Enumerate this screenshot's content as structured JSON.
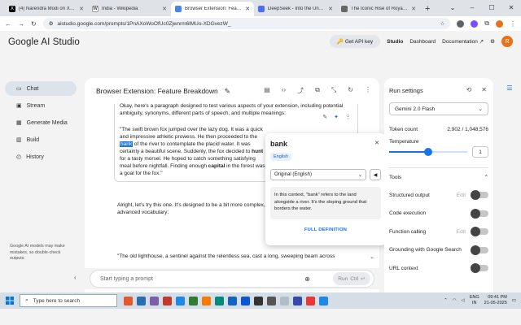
{
  "browser": {
    "tabs": [
      {
        "title": "(4) Narendra Modi on X: \"Dr",
        "favicon": "x-logo-icon",
        "color": "#000000",
        "letter": "X"
      },
      {
        "title": "India - Wikipedia",
        "favicon": "wikipedia-icon",
        "color": "#ffffff",
        "letter": "W"
      },
      {
        "title": "Browser Extension: Feature B",
        "favicon": "ai-studio-icon",
        "color": "#4285f4",
        "letter": "",
        "active": true
      },
      {
        "title": "DeepSeek - Into the Unknow",
        "favicon": "deepseek-icon",
        "color": "#4d6bfe",
        "letter": ""
      },
      {
        "title": "The Iconic Rise of Royal Enfi",
        "favicon": "page-icon",
        "color": "#666666",
        "letter": ""
      }
    ],
    "url": "aistudio.google.com/prompts/1PnAXoWoOfUc0Zjwnrm6lMUo-XDGvezW_"
  },
  "app": {
    "brand": "Google AI Studio",
    "get_api_key": "Get API key",
    "nav": [
      "Studio",
      "Dashboard",
      "Documentation"
    ],
    "avatar_letter": "R"
  },
  "sidebar": {
    "items": [
      {
        "label": "Chat",
        "icon": "chat-icon",
        "active": true
      },
      {
        "label": "Stream",
        "icon": "stream-icon"
      },
      {
        "label": "Generate Media",
        "icon": "media-icon"
      },
      {
        "label": "Build",
        "icon": "build-icon"
      },
      {
        "label": "History",
        "icon": "history-icon"
      }
    ],
    "note": "Google AI models may make mistakes, so double-check outputs."
  },
  "chat": {
    "title": "Browser Extension: Feature Breakdown",
    "msg1_intro": "Okay, here's a paragraph designed to test various aspects of your extension, including potential ambiguity, synonyms, different parts of speech, and multiple meanings:",
    "msg1_before": "\"The swift brown fox jumped over the lazy dog. It was a quick and impressive athletic prowess. He then proceeded to the ",
    "msg1_highlight": "bank",
    "msg1_mid": " of the river to contemplate the placid water. It was certainly a beautiful scene. Suddenly, the fox decided to ",
    "msg1_hunt": "hunt",
    "msg1_mid2": " for a tasty morsel. He hoped to catch something satisfying meal before nightfall. Finding enough ",
    "msg1_capital": "capital",
    "msg1_after": " in the forest was a goal for the fox.\"",
    "msg2": "Alright, let's try this one. It's designed to be a bit more complex, with nuanced words and more advanced vocabulary:",
    "msg3": "\"The old lighthouse, a sentinel against the relentless sea, cast a long, sweeping beam across",
    "prompt_placeholder": "Start typing a prompt",
    "run_label": "Run",
    "run_shortcut": "Ctrl"
  },
  "popup": {
    "word": "bank",
    "language_tag": "English",
    "language_select": "Original (English)",
    "definition": "In this context, \"bank\" refers to the land alongside a river. It's the sloping ground that borders the water.",
    "full_definition": "FULL DEFINITION"
  },
  "settings": {
    "title": "Run settings",
    "model": "Gemini 2.0 Flash",
    "token_label": "Token count",
    "token_value": "2,902 / 1,048,576",
    "temperature_label": "Temperature",
    "temperature_value": "1",
    "temperature_fraction": 0.5,
    "tools_label": "Tools",
    "tools": [
      {
        "label": "Structured output",
        "edit": "Edit"
      },
      {
        "label": "Code execution",
        "edit": ""
      },
      {
        "label": "Function calling",
        "edit": "Edit"
      },
      {
        "label": "Grounding with Google Search",
        "edit": ""
      },
      {
        "label": "URL context",
        "edit": ""
      }
    ]
  },
  "taskbar": {
    "search_placeholder": "Type here to search",
    "lang_top": "ENG",
    "lang_bottom": "IN",
    "time": "09:41 PM",
    "date": "21-05-2025",
    "icon_colors": [
      "#e05a2b",
      "#2b6cb0",
      "#7b5ea7",
      "#c0392b",
      "#1e88e5",
      "#2e7d32",
      "#f57c00",
      "#00897b",
      "#1565c0",
      "#0b57d0",
      "#333333",
      "#555555",
      "#b0bec5",
      "#3949ab",
      "#e53935",
      "#1e88e5"
    ]
  }
}
